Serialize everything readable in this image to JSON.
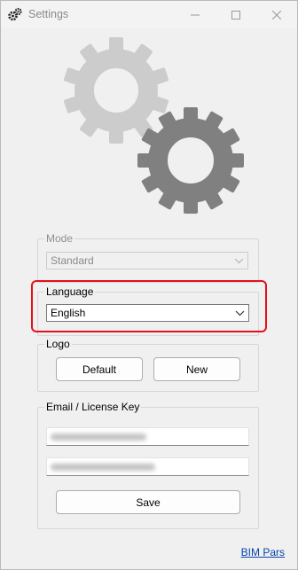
{
  "window": {
    "title": "Settings",
    "controls": {
      "minimize": "—",
      "maximize": "☐",
      "close": "✕"
    }
  },
  "graphic": {
    "icon": "gears-icon",
    "colors": {
      "light_gear": "#cccccc",
      "dark_gear": "#808080"
    }
  },
  "mode": {
    "label": "Mode",
    "value": "Standard",
    "enabled": false
  },
  "language": {
    "label": "Language",
    "value": "English",
    "enabled": true,
    "highlighted": true,
    "highlight_color": "#e4111b"
  },
  "logo": {
    "label": "Logo",
    "default_button": "Default",
    "new_button": "New"
  },
  "license": {
    "label": "Email / License Key",
    "save_button": "Save"
  },
  "footer": {
    "link": "BIM Pars"
  }
}
